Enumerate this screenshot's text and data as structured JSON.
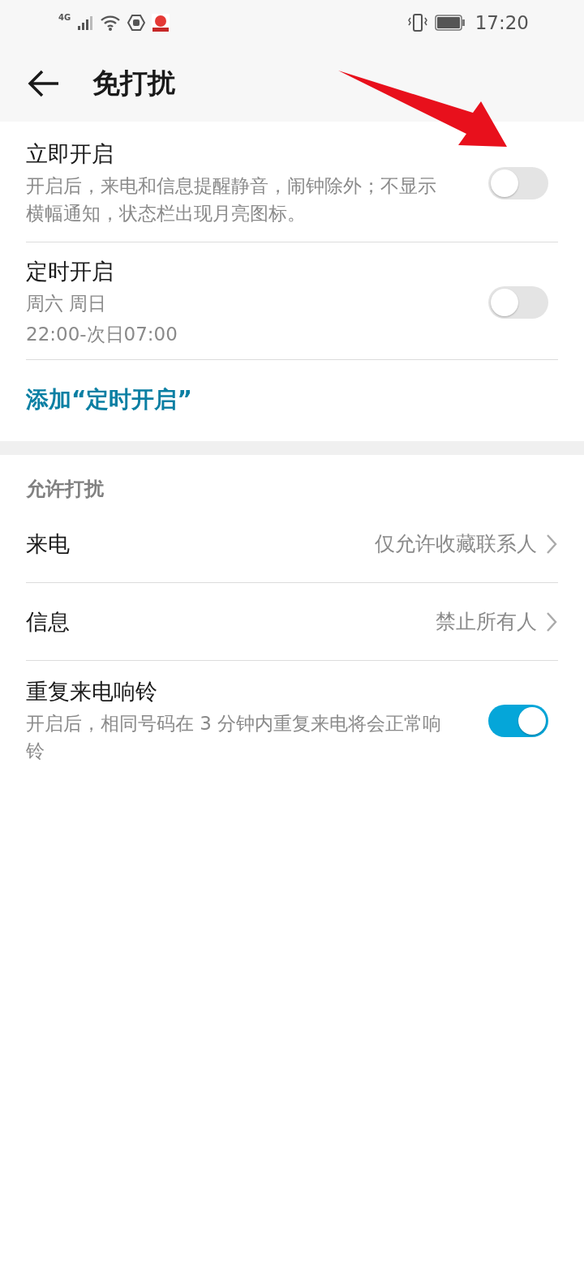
{
  "status_bar": {
    "network": "4G",
    "time": "17:20"
  },
  "header": {
    "title": "免打扰"
  },
  "schedule_section": {
    "items": [
      {
        "title": "立即开启",
        "subtitle": "开启后，来电和信息提醒静音，闹钟除外；不显示横幅通知，状态栏出现月亮图标。",
        "on": false
      },
      {
        "title": "定时开启",
        "subtitle": "周六 周日",
        "detail": "22:00-次日07:00",
        "on": false
      }
    ],
    "add_link": "添加“定时开启”"
  },
  "allow_section": {
    "heading": "允许打扰",
    "items": [
      {
        "kind": "choice",
        "title": "来电",
        "value": "仅允许收藏联系人"
      },
      {
        "kind": "choice",
        "title": "信息",
        "value": "禁止所有人"
      },
      {
        "kind": "toggle",
        "title": "重复来电响铃",
        "subtitle": "开启后，相同号码在 3 分钟内重复来电将会正常响铃",
        "on": true
      }
    ]
  }
}
